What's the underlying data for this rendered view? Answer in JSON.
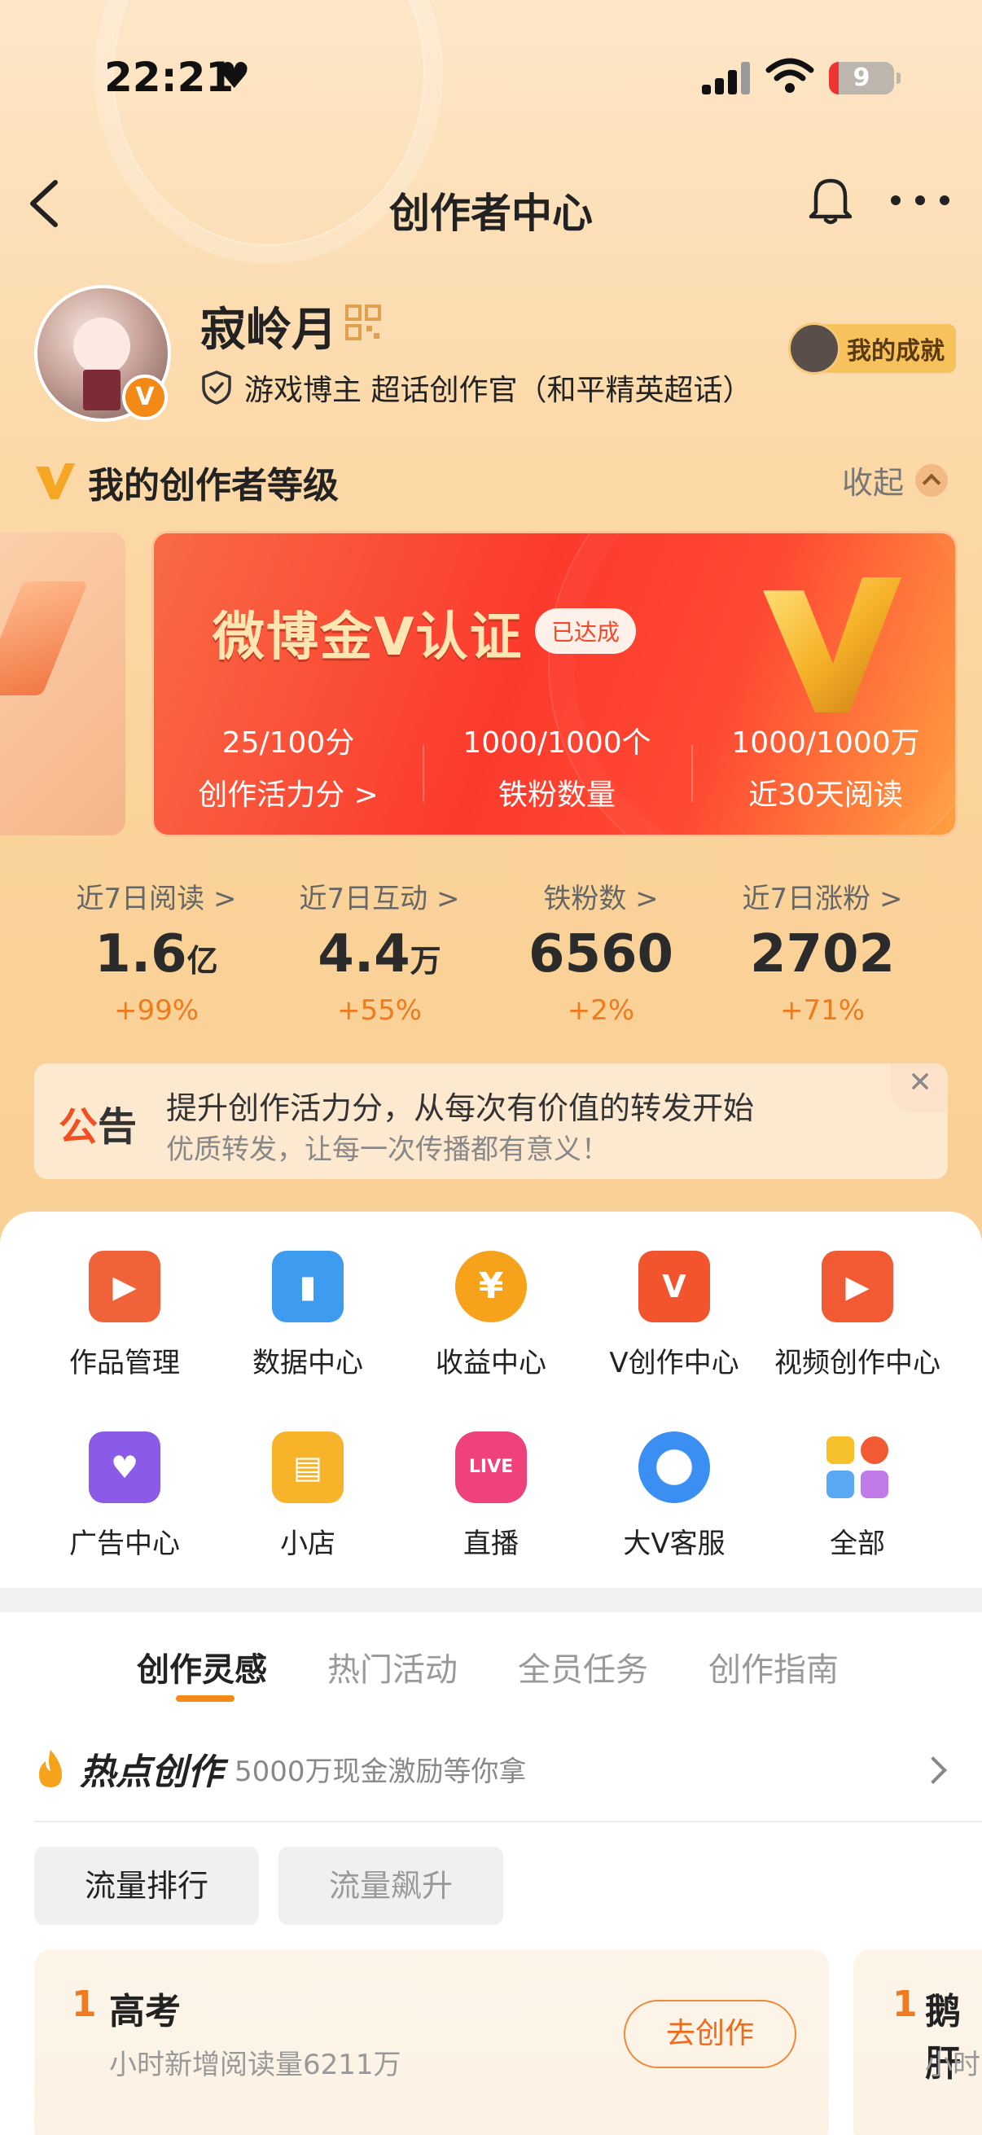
{
  "status": {
    "time": "22:21",
    "battery": "9"
  },
  "nav": {
    "title": "创作者中心"
  },
  "profile": {
    "name": "寂岭月",
    "tagline": "游戏博主 超话创作官（和平精英超话）",
    "achievement_label": "我的成就",
    "verified_badge": "V"
  },
  "level": {
    "title": "我的创作者等级",
    "collapse_label": "收起",
    "card": {
      "title": "微博金V认证",
      "achieved_label": "已达成",
      "stats": [
        {
          "value": "25/100分",
          "label": "创作活力分 >"
        },
        {
          "value": "1000/1000个",
          "label": "铁粉数量"
        },
        {
          "value": "1000/1000万",
          "label": "近30天阅读"
        }
      ]
    }
  },
  "metrics": [
    {
      "label": "近7日阅读 >",
      "value": "1.6",
      "unit": "亿",
      "delta": "+99%"
    },
    {
      "label": "近7日互动 >",
      "value": "4.4",
      "unit": "万",
      "delta": "+55%"
    },
    {
      "label": "铁粉数 >",
      "value": "6560",
      "unit": "",
      "delta": "+2%"
    },
    {
      "label": "近7日涨粉 >",
      "value": "2702",
      "unit": "",
      "delta": "+71%"
    }
  ],
  "notice": {
    "tag_a": "公",
    "tag_b": "告",
    "title": "提升创作活力分，从每次有价值的转发开始",
    "subtitle": "优质转发，让每一次传播都有意义！"
  },
  "tools": [
    {
      "label": "作品管理",
      "icon": "folder-play-icon",
      "color": "#f0623a"
    },
    {
      "label": "数据中心",
      "icon": "data-chart-icon",
      "color": "#3d9cf0"
    },
    {
      "label": "收益中心",
      "icon": "yuan-coin-icon",
      "color": "#f7a21b"
    },
    {
      "label": "V创作中心",
      "icon": "v-create-icon",
      "color": "#f2552e"
    },
    {
      "label": "视频创作中心",
      "icon": "video-camera-icon",
      "color": "#f25a34"
    },
    {
      "label": "广告中心",
      "icon": "ad-heart-icon",
      "color": "#8b5ae6"
    },
    {
      "label": "小店",
      "icon": "shop-icon",
      "color": "#f7b42b"
    },
    {
      "label": "直播",
      "icon": "live-icon",
      "color": "#f0427a"
    },
    {
      "label": "大V客服",
      "icon": "customer-service-icon",
      "color": "#3b8ff2"
    },
    {
      "label": "全部",
      "icon": "all-apps-icon",
      "color": "#f2552e"
    }
  ],
  "tabs": [
    "创作灵感",
    "热门活动",
    "全员任务",
    "创作指南"
  ],
  "hot": {
    "title": "热点创作",
    "subtitle": "5000万现金激励等你拿"
  },
  "filters": [
    "流量排行",
    "流量飙升"
  ],
  "rank_cards": [
    {
      "rank": "1",
      "name": "高考",
      "sub": "小时新增阅读量6211万",
      "button": "去创作"
    },
    {
      "rank": "1",
      "name": "鹅肝",
      "sub": "小时",
      "button": ""
    }
  ],
  "colors": {
    "accent": "#f28a15",
    "hero_bg": "#fcd9a8",
    "card_red": "#fc3a2c"
  }
}
